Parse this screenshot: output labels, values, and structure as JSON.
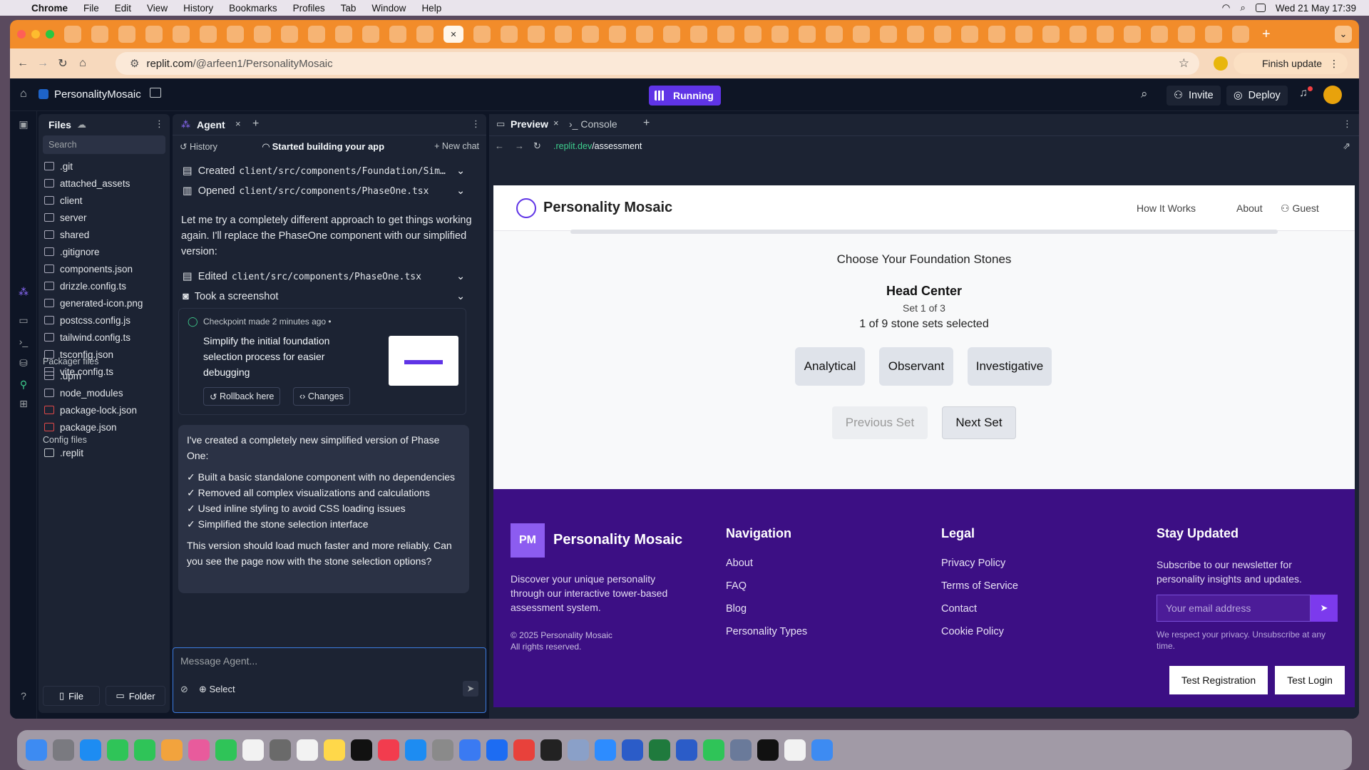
{
  "menubar": {
    "apple": "",
    "app": "Chrome",
    "items": [
      "File",
      "Edit",
      "View",
      "History",
      "Bookmarks",
      "Profiles",
      "Tab",
      "Window",
      "Help"
    ],
    "clock": "Wed 21 May  17:39"
  },
  "browser": {
    "url_host": "replit.com",
    "url_path": "/@arfeen1/PersonalityMosaic",
    "finish_update": "Finish update",
    "close_tab": "✕",
    "new_tab": "+"
  },
  "replit": {
    "project": "PersonalityMosaic",
    "running": "Running",
    "invite": "Invite",
    "deploy": "Deploy"
  },
  "files": {
    "title": "Files",
    "search_placeholder": "Search",
    "items": [
      ".git",
      "attached_assets",
      "client",
      "server",
      "shared",
      ".gitignore",
      "components.json",
      "drizzle.config.ts",
      "generated-icon.png",
      "postcss.config.js",
      "tailwind.config.ts",
      "tsconfig.json",
      "vite.config.ts"
    ],
    "packager_title": "Packager files",
    "packager": [
      ".upm",
      "node_modules",
      "package-lock.json",
      "package.json"
    ],
    "config_title": "Config files",
    "config": [
      ".replit"
    ],
    "file_btn": "File",
    "folder_btn": "Folder",
    "help": "?"
  },
  "agent": {
    "tab": "Agent",
    "history": "History",
    "status": "Started building your app",
    "new_chat": "New chat",
    "action1_label": "Created",
    "action1_path": "client/src/components/Foundation/Sim…",
    "action2_label": "Opened",
    "action2_path": "client/src/components/PhaseOne.tsx",
    "message1": "Let me try a completely different approach to get things working again. I'll replace the PhaseOne component with our simplified version:",
    "action3_label": "Edited",
    "action3_path": "client/src/components/PhaseOne.tsx",
    "action4": "Took a screenshot",
    "checkpoint_meta": "Checkpoint made 2 minutes ago  •",
    "checkpoint_text": "Simplify the initial foundation selection process for easier debugging",
    "rollback": "Rollback here",
    "changes": "Changes",
    "reply_intro": "I've created a completely new simplified version of Phase One:",
    "reply_points": [
      "✓ Built a basic standalone component with no dependencies",
      "✓ Removed all complex visualizations and calculations",
      "✓ Used inline styling to avoid CSS loading issues",
      "✓ Simplified the stone selection interface"
    ],
    "reply_end": "This version should load much faster and more reliably. Can you see the page now with the stone selection options?",
    "input_placeholder": "Message Agent...",
    "select": "Select"
  },
  "preview": {
    "tab": "Preview",
    "console": "Console",
    "url_host": ".replit.dev",
    "url_path": "/assessment"
  },
  "site": {
    "brand": "Personality Mosaic",
    "nav": [
      "How It Works",
      "About",
      "Guest"
    ],
    "choose": "Choose Your Foundation Stones",
    "center": "Head Center",
    "set": "Set 1 of 3",
    "progress": "1 of 9 stone sets selected",
    "stones": [
      "Analytical",
      "Observant",
      "Investigative"
    ],
    "prev": "Previous Set",
    "next": "Next Set",
    "footer": {
      "logo": "PM",
      "brand": "Personality Mosaic",
      "desc": "Discover your unique personality through our interactive tower-based assessment system.",
      "copyright": "© 2025 Personality Mosaic",
      "rights": "All rights reserved.",
      "nav_title": "Navigation",
      "nav": [
        "About",
        "FAQ",
        "Blog",
        "Personality Types"
      ],
      "legal_title": "Legal",
      "legal": [
        "Privacy Policy",
        "Terms of Service",
        "Contact",
        "Cookie Policy"
      ],
      "stay_title": "Stay Updated",
      "stay_desc": "Subscribe to our newsletter for personality insights and updates.",
      "email_placeholder": "Your email address",
      "privacy": "We respect your privacy. Unsubscribe at any time.",
      "test_reg": "Test Registration",
      "test_login": "Test Login"
    }
  },
  "colors": {
    "tabstrip": "#f28c2a",
    "replit_bg": "#0e1525",
    "panel": "#1c2333",
    "accent": "#5f34e6",
    "footer": "#3c0f84"
  }
}
